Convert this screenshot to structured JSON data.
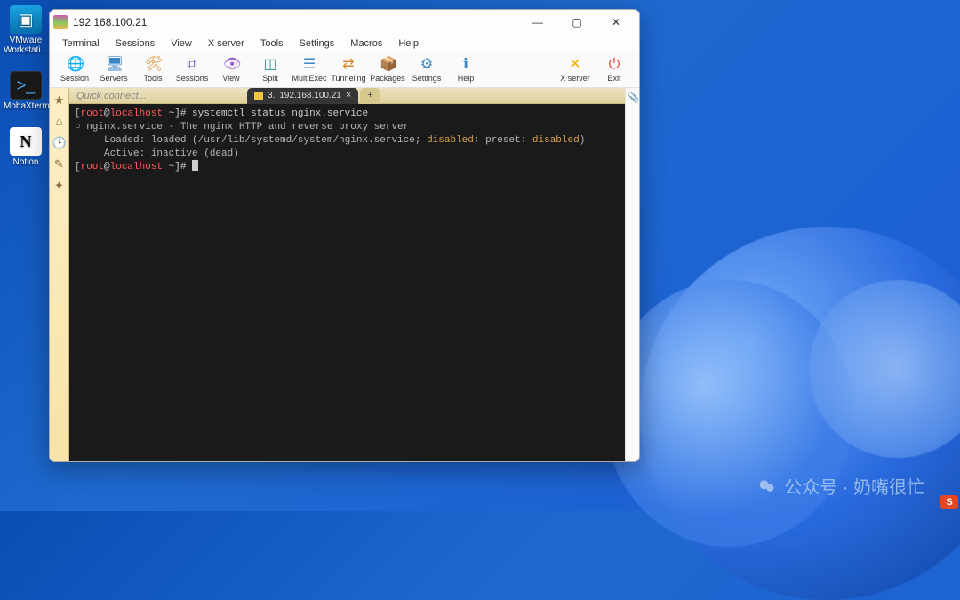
{
  "desktop": {
    "icons": [
      {
        "label": "VMware Workstati...",
        "name": "vmware-icon",
        "glyph": "▣"
      },
      {
        "label": "MobaXterm",
        "name": "mobaxterm-icon",
        "glyph": ">_"
      },
      {
        "label": "Notion",
        "name": "notion-icon",
        "glyph": "N"
      }
    ]
  },
  "window": {
    "title": "192.168.100.21",
    "controls": {
      "min": "—",
      "max": "▢",
      "close": "✕"
    },
    "menu": [
      "Terminal",
      "Sessions",
      "View",
      "X server",
      "Tools",
      "Settings",
      "Macros",
      "Help"
    ],
    "toolbar": [
      {
        "label": "Session",
        "icon": "🌐",
        "cls": "c-globe",
        "name": "session-button"
      },
      {
        "label": "Servers",
        "icon": "🖥",
        "cls": "c-serv",
        "name": "servers-button"
      },
      {
        "label": "Tools",
        "icon": "🛠",
        "cls": "c-tools",
        "name": "tools-button"
      },
      {
        "label": "Sessions",
        "icon": "⧉",
        "cls": "c-sess",
        "name": "sessions-button"
      },
      {
        "label": "View",
        "icon": "👁",
        "cls": "c-view",
        "name": "view-button"
      },
      {
        "label": "Split",
        "icon": "◫",
        "cls": "c-split",
        "name": "split-button"
      },
      {
        "label": "MultiExec",
        "icon": "☰",
        "cls": "c-multi",
        "name": "multiexec-button"
      },
      {
        "label": "Tunneling",
        "icon": "⇄",
        "cls": "c-tunnel",
        "name": "tunneling-button"
      },
      {
        "label": "Packages",
        "icon": "📦",
        "cls": "c-pkg",
        "name": "packages-button"
      },
      {
        "label": "Settings",
        "icon": "⚙",
        "cls": "c-gear",
        "name": "settings-button"
      },
      {
        "label": "Help",
        "icon": "ℹ",
        "cls": "c-help",
        "name": "help-button"
      }
    ],
    "toolbar_right": [
      {
        "label": "X server",
        "icon": "✕",
        "cls": "c-x",
        "name": "xserver-button"
      },
      {
        "label": "Exit",
        "icon": "⏻",
        "cls": "c-exit",
        "name": "exit-button"
      }
    ],
    "quick_connect": "Quick connect...",
    "tab": {
      "index": "3.",
      "title": "192.168.100.21",
      "close": "×",
      "plus": "+"
    },
    "sidebar_icons": [
      "★",
      "⌂",
      "🕒",
      "✎",
      "✦"
    ]
  },
  "terminal": {
    "prompt_user": "root",
    "prompt_at": "@",
    "prompt_host": "localhost",
    "prompt_path": " ~]#",
    "command": " systemctl status nginx.service",
    "line2_bullet": "○ ",
    "line2": "nginx.service - The nginx HTTP and reverse proxy server",
    "line3_pre": "     Loaded: loaded (/usr/lib/systemd/system/nginx.service; ",
    "line3_disabled": "disabled",
    "line3_mid": "; preset: ",
    "line3_disabled2": "disabled",
    "line3_end": ")",
    "line4": "     Active: inactive (dead)"
  },
  "watermark": {
    "text": "公众号 · 奶嘴很忙"
  },
  "badge": "S"
}
